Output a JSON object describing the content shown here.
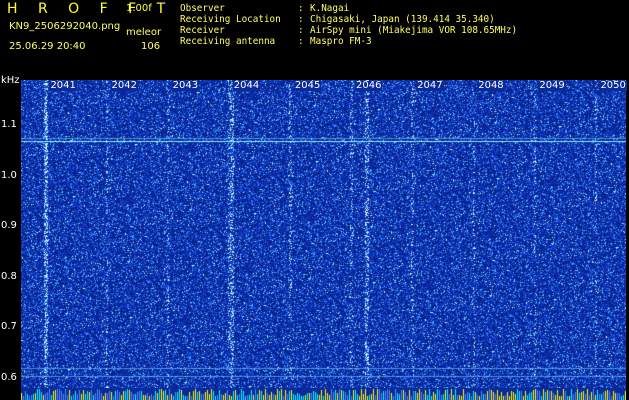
{
  "header": {
    "logo": "H R O F F T",
    "version": "1.00f",
    "filename": "KN9_2506292040.png",
    "meleor_label": "meleor",
    "datetime": "25.06.29 20:40",
    "count": "106"
  },
  "info": [
    {
      "key": "Observer",
      "sep": ":",
      "value": "K.Nagai"
    },
    {
      "key": "Receiving Location",
      "sep": ":",
      "value": "Chigasaki, Japan (139.414 35.340)"
    },
    {
      "key": "Receiver",
      "sep": ":",
      "value": "AirSpy mini (Miakejima VOR 108.65MHz)"
    },
    {
      "key": "Receiving antenna",
      "sep": ":",
      "value": "Maspro FM-3"
    }
  ],
  "axis": {
    "unit": "kHz",
    "y_ticks": [
      "1.1",
      "1.0",
      "0.9",
      "0.8",
      "0.7",
      "0.6"
    ],
    "y_tick_values": [
      1.1,
      1.0,
      0.9,
      0.8,
      0.7,
      0.6
    ],
    "x_ticks": [
      "2041",
      "2042",
      "2043",
      "2044",
      "2045",
      "2046",
      "2047",
      "2048",
      "2049",
      "2050"
    ],
    "y_range": [
      0.58,
      1.19
    ]
  },
  "features": {
    "horizontal_lines_khz": [
      1.07,
      1.076,
      0.62,
      0.604
    ],
    "vertical_streaks_minute": [
      2041.0,
      2044.05,
      2046.25
    ],
    "colors": {
      "background": "#08228f",
      "noise_light": "#3a7bff",
      "noise_bright": "#9fe7ff",
      "line_cyan": "#7ff6ff",
      "bar_yellow": "#ffff00",
      "bar_cyan": "#00ffff",
      "text_yellow": "#ffff66",
      "text_white": "#ffffff"
    }
  }
}
